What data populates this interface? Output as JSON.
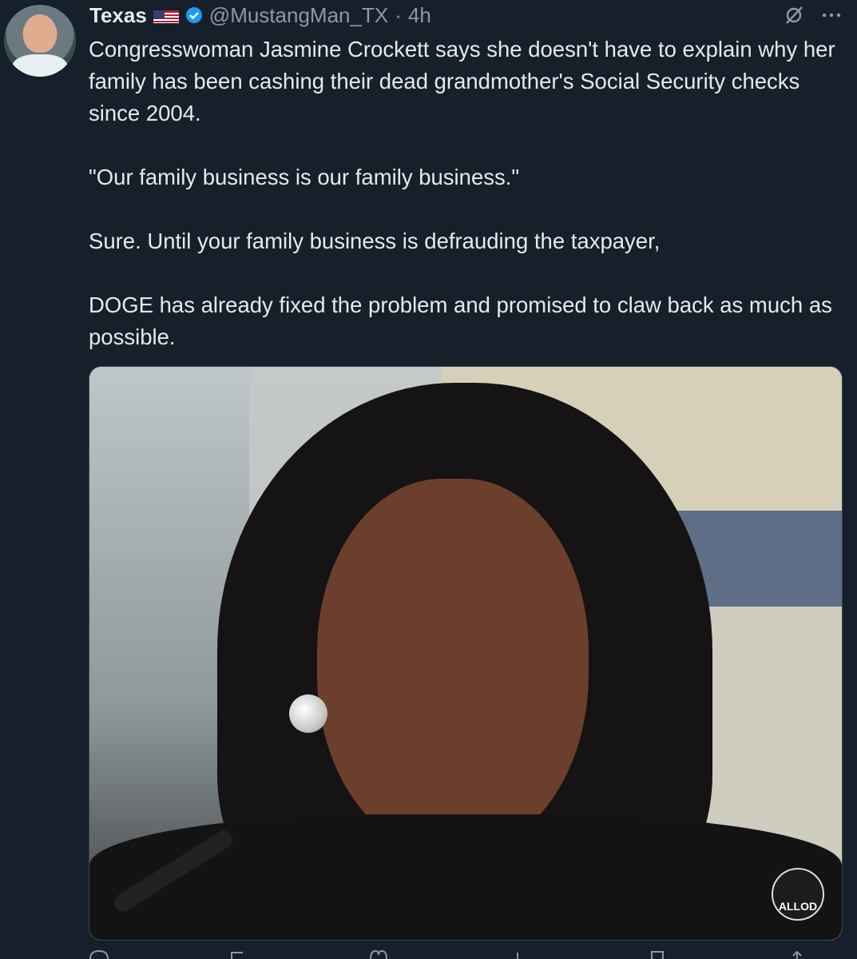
{
  "tweet": {
    "display_name": "Texas",
    "handle": "@MustangMan_TX",
    "separator": "·",
    "time": "4h",
    "body": "Congresswoman Jasmine Crockett says she doesn't have to explain why her family has been cashing their dead grandmother's Social Security checks since 2004.\n\n\"Our family business is our family business.\"\n\nSure. Until your family business is defrauding the taxpayer,\n\nDOGE has already fixed the problem and promised to claw back as much as possible.",
    "media_watermark": "ALLOD"
  },
  "icons": {
    "flag": "us-flag-icon",
    "verified": "verified-badge-icon",
    "grok": "grok-icon",
    "more": "more-icon"
  },
  "colors": {
    "background": "#15202b",
    "text": "#e7e9ea",
    "muted": "#8b98a5",
    "verified": "#1d9bf0"
  }
}
